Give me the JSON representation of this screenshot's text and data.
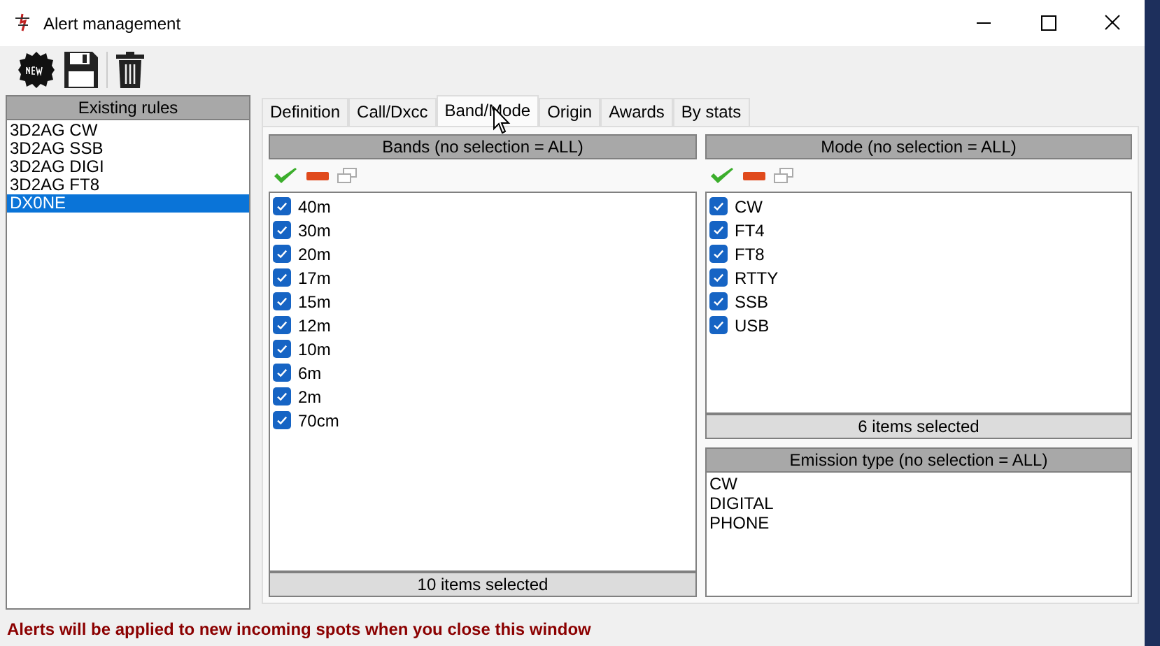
{
  "window": {
    "title": "Alert management"
  },
  "rules": {
    "header": "Existing rules",
    "items": [
      {
        "label": "3D2AG CW",
        "selected": false
      },
      {
        "label": "3D2AG SSB",
        "selected": false
      },
      {
        "label": "3D2AG DIGI",
        "selected": false
      },
      {
        "label": "3D2AG FT8",
        "selected": false
      },
      {
        "label": "DX0NE",
        "selected": true
      }
    ]
  },
  "tabs": [
    {
      "label": "Definition",
      "selected": false
    },
    {
      "label": "Call/Dxcc",
      "selected": false
    },
    {
      "label": "Band/Mode",
      "selected": true
    },
    {
      "label": "Origin",
      "selected": false
    },
    {
      "label": "Awards",
      "selected": false
    },
    {
      "label": "By stats",
      "selected": false
    }
  ],
  "bands": {
    "header": "Bands (no selection = ALL)",
    "footer": "10 items selected",
    "items": [
      {
        "label": "40m",
        "checked": true
      },
      {
        "label": "30m",
        "checked": true
      },
      {
        "label": "20m",
        "checked": true
      },
      {
        "label": "17m",
        "checked": true
      },
      {
        "label": "15m",
        "checked": true
      },
      {
        "label": "12m",
        "checked": true
      },
      {
        "label": "10m",
        "checked": true
      },
      {
        "label": "6m",
        "checked": true
      },
      {
        "label": "2m",
        "checked": true
      },
      {
        "label": "70cm",
        "checked": true
      }
    ]
  },
  "modes": {
    "header": "Mode (no selection = ALL)",
    "footer": "6 items selected",
    "items": [
      {
        "label": "CW",
        "checked": true
      },
      {
        "label": "FT4",
        "checked": true
      },
      {
        "label": "FT8",
        "checked": true
      },
      {
        "label": "RTTY",
        "checked": true
      },
      {
        "label": "SSB",
        "checked": true
      },
      {
        "label": "USB",
        "checked": true
      }
    ]
  },
  "emission": {
    "header": "Emission type (no selection = ALL)",
    "items": [
      "CW",
      "DIGITAL",
      "PHONE"
    ]
  },
  "status_bar": "Alerts will be applied to new incoming spots when you close this window"
}
